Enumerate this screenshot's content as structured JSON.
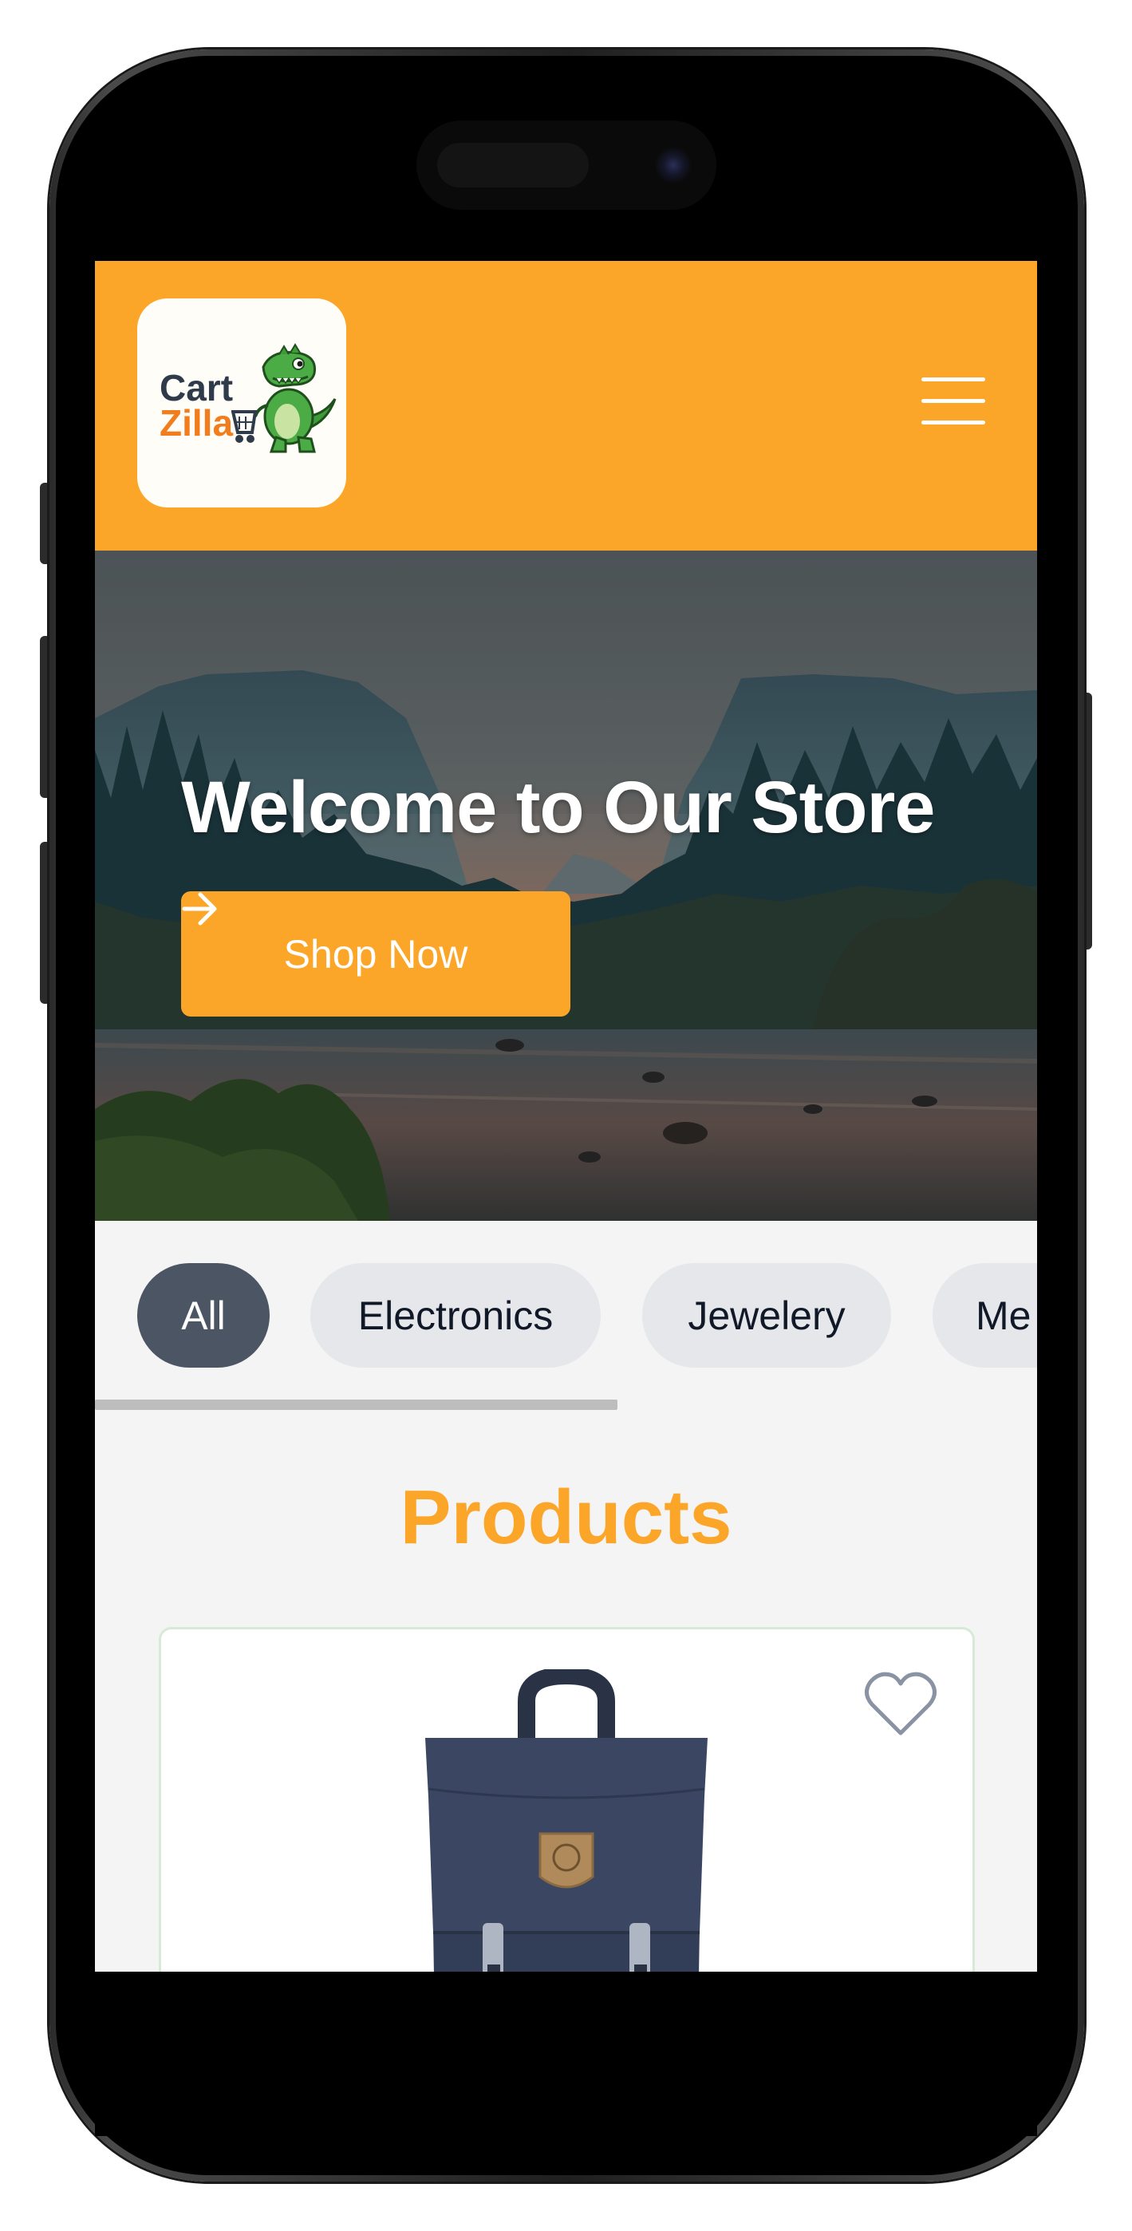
{
  "header": {
    "logo": {
      "line1": "Cart",
      "line2": "Zilla",
      "icon": "dinosaur-shopping-cart-logo",
      "line1_color": "#2f3b4a",
      "line2_color": "#f27d1d"
    },
    "menu_icon": "hamburger-menu-icon",
    "background": "#fca629"
  },
  "hero": {
    "title": "Welcome to Our Store",
    "cta_label": "Shop Now",
    "cta_icon": "arrow-right-icon",
    "image": "mountain-valley-river-landscape"
  },
  "categories": {
    "items": [
      {
        "label": "All",
        "active": true
      },
      {
        "label": "Electronics",
        "active": false
      },
      {
        "label": "Jewelery",
        "active": false
      },
      {
        "label": "Me",
        "active": false
      }
    ]
  },
  "products": {
    "title": "Products",
    "items": [
      {
        "image": "navy-backpack-image",
        "favorite_icon": "heart-outline-icon"
      }
    ]
  },
  "colors": {
    "accent": "#fca629",
    "chip_active": "#4b5563",
    "chip_inactive": "#e5e7eb"
  }
}
